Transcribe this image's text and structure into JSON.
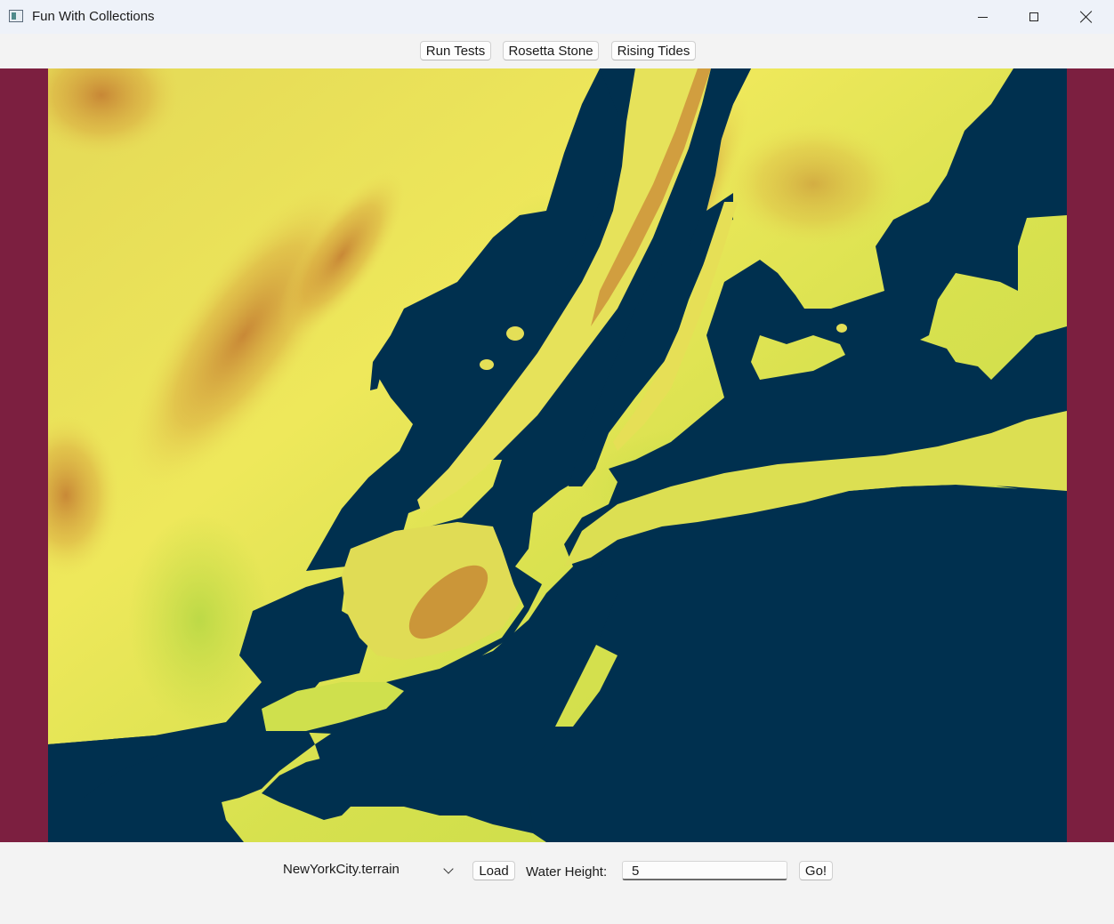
{
  "window": {
    "title": "Fun With Collections",
    "icon": "app-window-icon",
    "controls": [
      "minimize-icon",
      "maximize-icon",
      "close-icon"
    ]
  },
  "toolbar": {
    "buttons": [
      "Run Tests",
      "Rosetta Stone",
      "Rising Tides"
    ]
  },
  "map": {
    "description_colors": {
      "water": "#00304f",
      "low_land": "#c2dc46",
      "mid_land": "#e9e459",
      "high_land": "#c47a2c",
      "border": "#7c1f40"
    }
  },
  "controls": {
    "terrain_select": "NewYorkCity.terrain",
    "load_label": "Load",
    "water_height_label": "Water Height:",
    "water_height_value": "5",
    "go_label": "Go!"
  }
}
